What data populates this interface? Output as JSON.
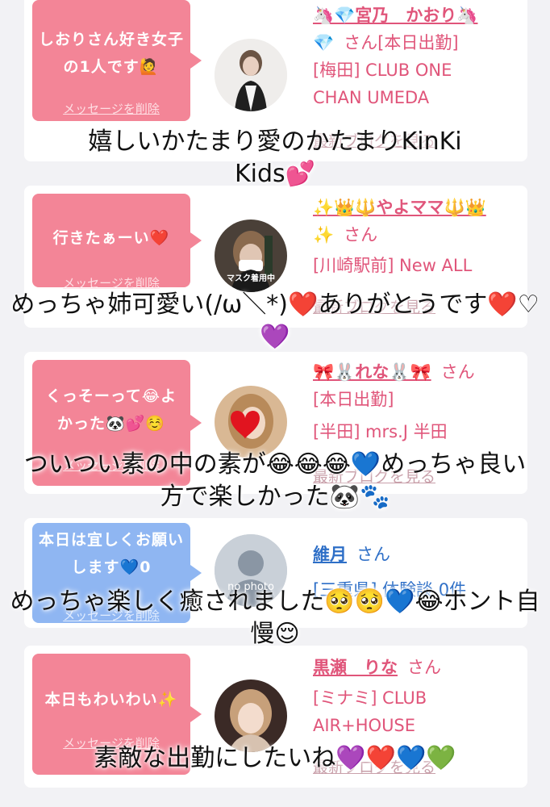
{
  "cards": [
    {
      "bubble_text": "しおりさん好き女子の1人です🙋",
      "bubble_delete": "メッセージを削除",
      "name": "🦄💎宮乃　かおり🦄",
      "name_line2": "💎",
      "honorific": "さん",
      "status": "[本日出勤]",
      "shop_line1": "[梅田] CLUB ONE",
      "shop_line2": "CHAN UMEDA",
      "blog_link": "最新ブログを見る"
    },
    {
      "bubble_text": "行きたぁーい❤️",
      "bubble_delete": "メッセージを削除",
      "name": "✨👑🔱やよママ🔱👑",
      "name_line2": "✨",
      "honorific": "さん",
      "shop_line1": "[川崎駅前] New ALL",
      "blog_link": "最新ブログを見る",
      "avatar_caption": "マスク着用中"
    },
    {
      "bubble_text": "くっそーって😂よかった🐼💕☺️",
      "bubble_delete": "メッセージを削除",
      "name": "🎀🐰れな🐰🎀",
      "honorific": "さん",
      "status": "[本日出勤]",
      "shop_line1": "[半田] mrs.J 半田",
      "blog_link": "最新ブログを見る"
    },
    {
      "bubble_text": "本日は宜しくお願いします💙0",
      "bubble_delete": "メッセージを削除",
      "name": "維月",
      "honorific": "さん",
      "shop_line1": "[三重県] 体験談 0件",
      "avatar_caption": "no photo"
    },
    {
      "bubble_text": "本日もわいわい✨",
      "bubble_delete": "メッセージを削除",
      "name": "黒瀬　りな",
      "honorific": "さん",
      "shop_line1": "[ミナミ] CLUB",
      "shop_line2": "AIR+HOUSE",
      "blog_link": "最新ブログを見る"
    }
  ],
  "overlays": {
    "o1": "嬉しいかたまり愛のかたまりKinKi Kids💕",
    "o2": "めっちゃ姉可愛い(/ω＼*)❤️ありがとうです❤️♡💜",
    "o3": "ついつい素の中の素が😂😂😂💙めっちゃ良い方で楽しかった🐼🐾",
    "o4": "めっちゃ楽しく癒されました🥺🥺💙😂ホント自慢😌",
    "o5": "素敵な出勤にしたいね💜❤️💙💚"
  },
  "colors": {
    "bubble_pink": "#f38597",
    "bubble_blue": "#8fb6f2",
    "accent_pink": "#e0557a",
    "name_blue": "#2e6fc7"
  }
}
